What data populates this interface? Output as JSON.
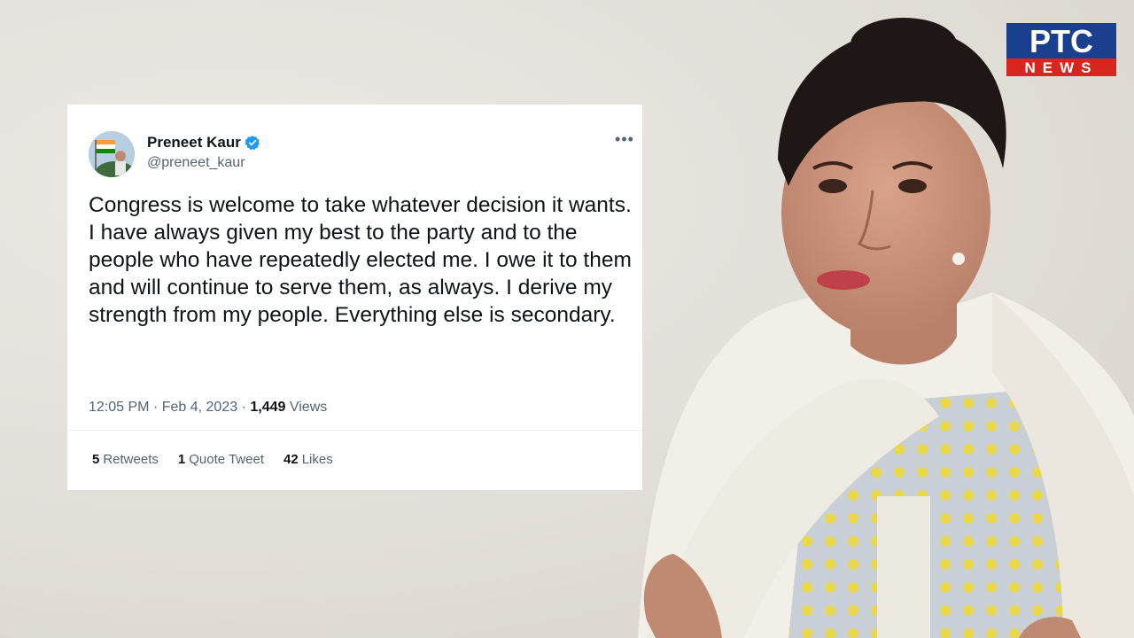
{
  "logo": {
    "top": "PTC",
    "bottom": "NEWS"
  },
  "tweet": {
    "author_name": "Preneet Kaur",
    "handle": "@preneet_kaur",
    "verified": true,
    "more_icon": "more-horizontal-icon",
    "text_lines": [
      "Congress is welcome to take whatever decision it wants.",
      "I have always given my best to the party and to the people who have repeatedly elected me. I owe it to them and will continue to serve them, as always. I derive my strength from my people. Everything else is secondary."
    ],
    "time": "12:05 PM",
    "date": "Feb 4, 2023",
    "views_count": "1,449",
    "views_label": "Views",
    "stats": {
      "retweets_count": "5",
      "retweets_label": "Retweets",
      "quotes_count": "1",
      "quotes_label": "Quote Tweet",
      "likes_count": "42",
      "likes_label": "Likes"
    }
  },
  "colors": {
    "logo_red": "#d7261e",
    "logo_blue": "#1a3f8f",
    "verified_blue": "#1d9bf0",
    "text_primary": "#0f1419",
    "text_secondary": "#536471"
  }
}
